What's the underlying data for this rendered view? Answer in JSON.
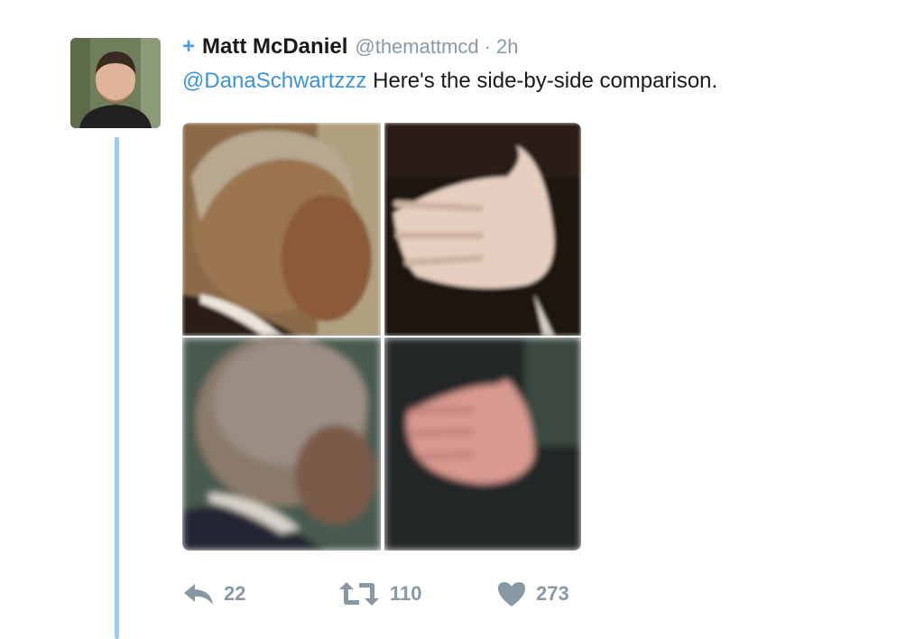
{
  "tweet": {
    "follow_symbol": "+",
    "author_name": "Matt McDaniel",
    "author_handle": "@themattmcd",
    "separator": "·",
    "time": "2h",
    "mention": "@DanaSchwartzzz",
    "text": " Here's the side-by-side comparison."
  },
  "actions": {
    "reply_count": "22",
    "retweet_count": "110",
    "like_count": "273"
  },
  "colors": {
    "accent": "#3b94d9",
    "muted": "#8899a6",
    "thread_line": "#9ccbf0"
  },
  "icons": {
    "reply": "reply-icon",
    "retweet": "retweet-icon",
    "like": "heart-icon"
  }
}
